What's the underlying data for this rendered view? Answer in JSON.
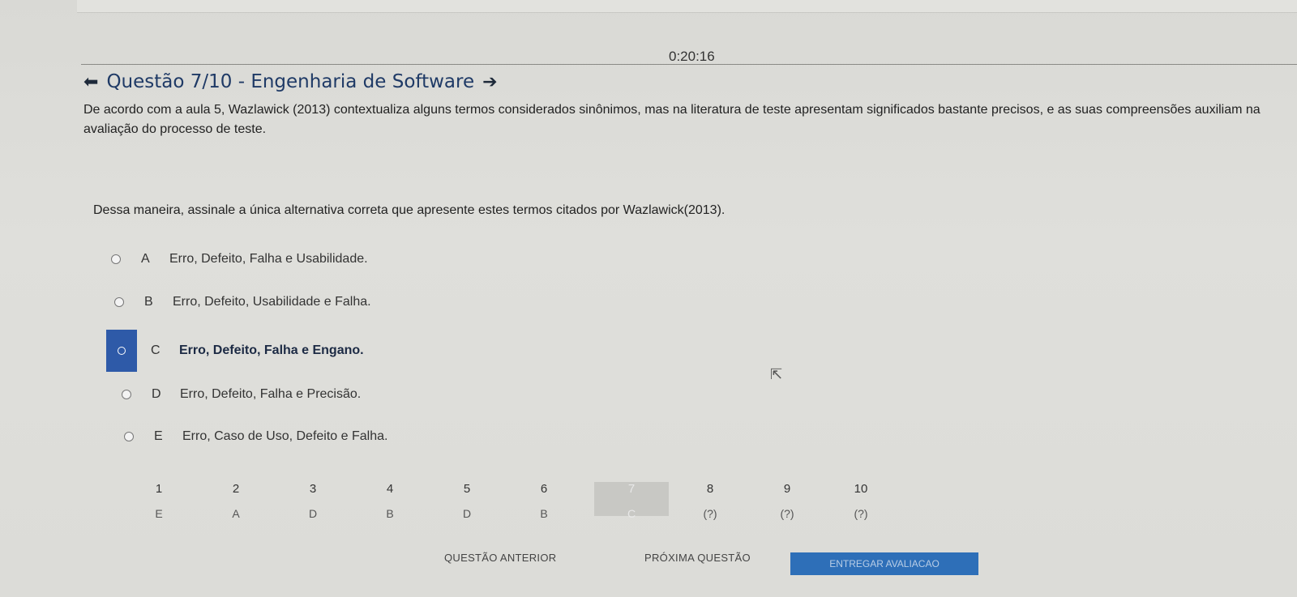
{
  "timer": "0:20:16",
  "question": {
    "title": "Questão 7/10 - Engenharia de Software",
    "text": "De acordo com a aula 5, Wazlawick (2013) contextualiza alguns termos considerados sinônimos, mas na literatura de teste apresentam significados bastante precisos, e as suas compreensões auxiliam na avaliação do processo de teste.",
    "instruction": "Dessa maneira, assinale a única alternativa correta que apresente estes termos citados por Wazlawick(2013).",
    "prev_icon": "arrow-left-icon",
    "next_icon": "arrow-right-icon"
  },
  "options": [
    {
      "letter": "A",
      "text": "Erro, Defeito, Falha e Usabilidade."
    },
    {
      "letter": "B",
      "text": "Erro, Defeito, Usabilidade e Falha."
    },
    {
      "letter": "C",
      "text": "Erro, Defeito, Falha e Engano.",
      "selected": true
    },
    {
      "letter": "D",
      "text": "Erro, Defeito, Falha e Precisão."
    },
    {
      "letter": "E",
      "text": "Erro, Caso de Uso, Defeito e Falha."
    }
  ],
  "navigator": [
    {
      "num": "1",
      "ans": "E"
    },
    {
      "num": "2",
      "ans": "A"
    },
    {
      "num": "3",
      "ans": "D"
    },
    {
      "num": "4",
      "ans": "B"
    },
    {
      "num": "5",
      "ans": "D"
    },
    {
      "num": "6",
      "ans": "B"
    },
    {
      "num": "7",
      "ans": "C",
      "active": true
    },
    {
      "num": "8",
      "ans": "(?)"
    },
    {
      "num": "9",
      "ans": "(?)"
    },
    {
      "num": "10",
      "ans": "(?)"
    }
  ],
  "buttons": {
    "prev": "QUESTÃO ANTERIOR",
    "next": "PRÓXIMA QUESTÃO",
    "submit": "ENTREGAR AVALIACAO"
  },
  "colors": {
    "accent": "#2e5aa8",
    "submit": "#2e6fb8",
    "title": "#1f3a66"
  }
}
